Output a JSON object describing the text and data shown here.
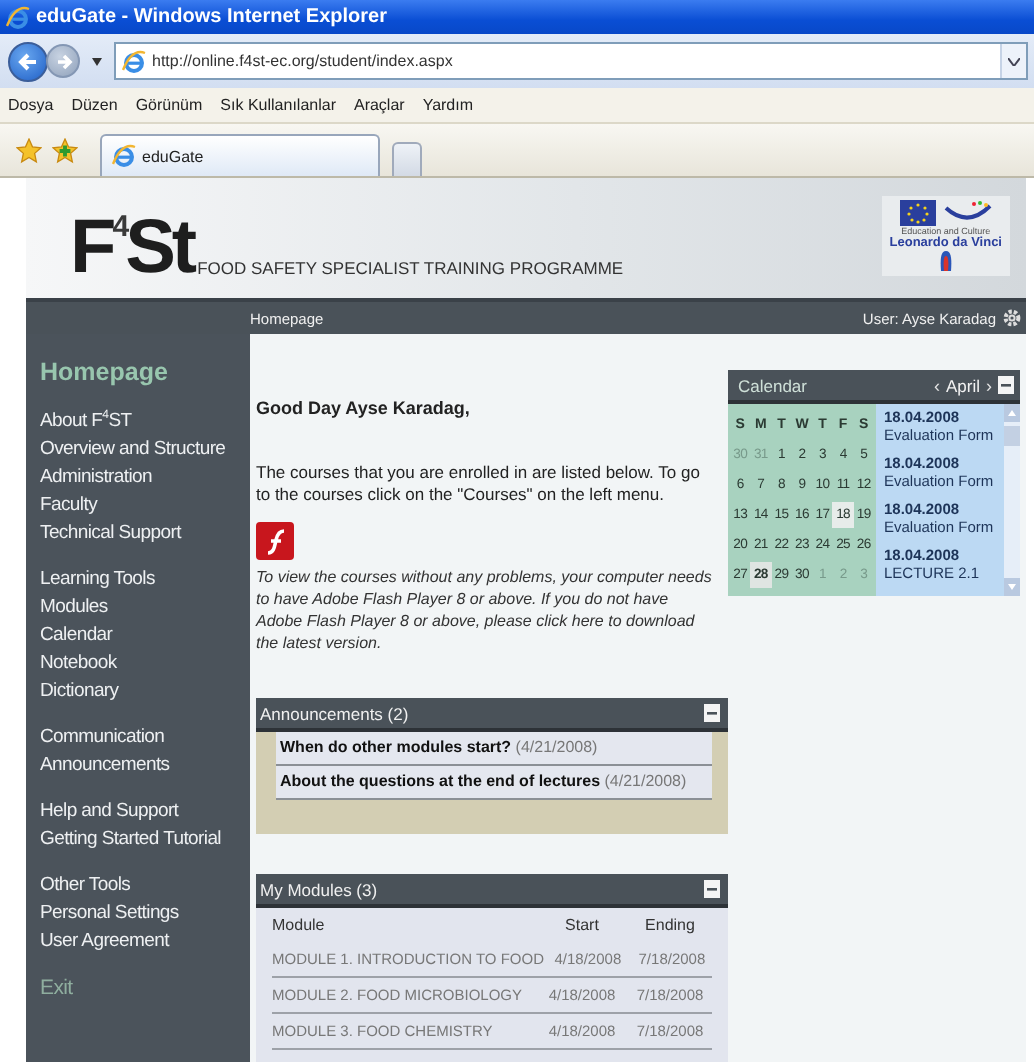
{
  "window": {
    "title": "eduGate - Windows Internet Explorer"
  },
  "address_bar": {
    "url": "http://online.f4st-ec.org/student/index.aspx"
  },
  "menu_bar": [
    "Dosya",
    "Düzen",
    "Görünüm",
    "Sık Kullanılanlar",
    "Araçlar",
    "Yardım"
  ],
  "tabs": [
    {
      "label": "eduGate",
      "selected": true
    }
  ],
  "site_header": {
    "logo": "F$^{4}$St",
    "tagline": "FOOD SAFETY SPECIALIST TRAINING PROGRAMME",
    "partner_caption": "Education and Culture",
    "partner_name": "Leonardo da Vinci"
  },
  "nav_bar": {
    "breadcrumb": "Homepage",
    "user": "User: Ayse Karadag"
  },
  "sidebar": {
    "groups": [
      [
        {
          "label": "Homepage",
          "kind": "heading"
        }
      ],
      [
        {
          "label": "About F$^{4}$ST",
          "kind": "link"
        },
        {
          "label": "Overview and Structure",
          "kind": "link"
        },
        {
          "label": "Administration",
          "kind": "link"
        },
        {
          "label": "Faculty",
          "kind": "link"
        },
        {
          "label": "Technical Support",
          "kind": "link"
        }
      ],
      [
        {
          "label": "Learning Tools",
          "kind": "link"
        },
        {
          "label": "Modules",
          "kind": "link"
        },
        {
          "label": "Calendar",
          "kind": "link"
        },
        {
          "label": "Notebook",
          "kind": "link"
        },
        {
          "label": "Dictionary",
          "kind": "link"
        }
      ],
      [
        {
          "label": "Communication",
          "kind": "link"
        },
        {
          "label": "Announcements",
          "kind": "link"
        }
      ],
      [
        {
          "label": "Help and Support",
          "kind": "link"
        },
        {
          "label": "Getting Started Tutorial",
          "kind": "link"
        }
      ],
      [
        {
          "label": "Other Tools",
          "kind": "link"
        },
        {
          "label": "Personal Settings",
          "kind": "link"
        },
        {
          "label": "User Agreement",
          "kind": "link"
        }
      ],
      [
        {
          "label": "Exit",
          "kind": "exit"
        }
      ]
    ]
  },
  "welcome": {
    "greeting": "Good Day Ayse Karadag,",
    "intro": "The courses that you are enrolled in are listed below. To go to the courses click on the \"Courses\" on the left menu.",
    "flash_note": "To view the courses without any problems, your computer needs to have Adobe Flash Player 8 or above. If you do not have Adobe Flash Player 8 or above, please click here to download the latest version."
  },
  "calendar": {
    "title": "Calendar",
    "prev": "‹",
    "month": "April",
    "next": "›",
    "weekdays": [
      "S",
      "M",
      "T",
      "W",
      "T",
      "F",
      "S"
    ],
    "weeks": [
      [
        {
          "day": "30",
          "other_month": true,
          "event": false,
          "today": false
        },
        {
          "day": "31",
          "other_month": true,
          "event": false,
          "today": false
        },
        {
          "day": "1",
          "other_month": false,
          "event": false,
          "today": false
        },
        {
          "day": "2",
          "other_month": false,
          "event": false,
          "today": false
        },
        {
          "day": "3",
          "other_month": false,
          "event": false,
          "today": false
        },
        {
          "day": "4",
          "other_month": false,
          "event": false,
          "today": false
        },
        {
          "day": "5",
          "other_month": false,
          "event": false,
          "today": false
        }
      ],
      [
        {
          "day": "6",
          "other_month": false,
          "event": false,
          "today": false
        },
        {
          "day": "7",
          "other_month": false,
          "event": false,
          "today": false
        },
        {
          "day": "8",
          "other_month": false,
          "event": false,
          "today": false
        },
        {
          "day": "9",
          "other_month": false,
          "event": false,
          "today": false
        },
        {
          "day": "10",
          "other_month": false,
          "event": false,
          "today": false
        },
        {
          "day": "11",
          "other_month": false,
          "event": false,
          "today": false
        },
        {
          "day": "12",
          "other_month": false,
          "event": false,
          "today": false
        }
      ],
      [
        {
          "day": "13",
          "other_month": false,
          "event": false,
          "today": false
        },
        {
          "day": "14",
          "other_month": false,
          "event": false,
          "today": false
        },
        {
          "day": "15",
          "other_month": false,
          "event": false,
          "today": false
        },
        {
          "day": "16",
          "other_month": false,
          "event": false,
          "today": false
        },
        {
          "day": "17",
          "other_month": false,
          "event": false,
          "today": false
        },
        {
          "day": "18",
          "other_month": false,
          "event": true,
          "today": false
        },
        {
          "day": "19",
          "other_month": false,
          "event": false,
          "today": false
        }
      ],
      [
        {
          "day": "20",
          "other_month": false,
          "event": false,
          "today": false
        },
        {
          "day": "21",
          "other_month": false,
          "event": false,
          "today": false
        },
        {
          "day": "22",
          "other_month": false,
          "event": false,
          "today": false
        },
        {
          "day": "23",
          "other_month": false,
          "event": false,
          "today": false
        },
        {
          "day": "24",
          "other_month": false,
          "event": false,
          "today": false
        },
        {
          "day": "25",
          "other_month": false,
          "event": false,
          "today": false
        },
        {
          "day": "26",
          "other_month": false,
          "event": false,
          "today": false
        }
      ],
      [
        {
          "day": "27",
          "other_month": false,
          "event": false,
          "today": false
        },
        {
          "day": "28",
          "other_month": false,
          "event": false,
          "today": true
        },
        {
          "day": "29",
          "other_month": false,
          "event": false,
          "today": false
        },
        {
          "day": "30",
          "other_month": false,
          "event": false,
          "today": false
        },
        {
          "day": "1",
          "other_month": true,
          "event": false,
          "today": false
        },
        {
          "day": "2",
          "other_month": true,
          "event": false,
          "today": false
        },
        {
          "day": "3",
          "other_month": true,
          "event": false,
          "today": false
        }
      ]
    ],
    "events": [
      {
        "date": "18.04.2008",
        "title": "Evaluation Form"
      },
      {
        "date": "18.04.2008",
        "title": "Evaluation Form"
      },
      {
        "date": "18.04.2008",
        "title": "Evaluation Form"
      },
      {
        "date": "18.04.2008",
        "title": "LECTURE 2.1"
      }
    ]
  },
  "announcements": {
    "title": "Announcements (2)",
    "items": [
      {
        "title": "When do other modules start?",
        "date": "(4/21/2008)"
      },
      {
        "title": "About the questions at the end of lectures",
        "date": "(4/21/2008)"
      }
    ]
  },
  "modules": {
    "title": "My Modules (3)",
    "columns": [
      "Module",
      "Start",
      "Ending"
    ],
    "rows": [
      [
        "MODULE 1. INTRODUCTION TO FOOD",
        "4/18/2008",
        "7/18/2008"
      ],
      [
        "MODULE 2. FOOD MICROBIOLOGY",
        "4/18/2008",
        "7/18/2008"
      ],
      [
        "MODULE 3. FOOD CHEMISTRY",
        "4/18/2008",
        "7/18/2008"
      ]
    ]
  }
}
